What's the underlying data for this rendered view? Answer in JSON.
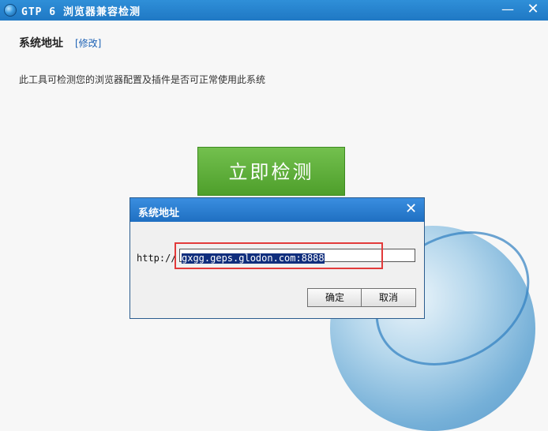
{
  "window": {
    "title": "GTP 6 浏览器兼容检测",
    "minimize": "—",
    "close": "✕"
  },
  "main": {
    "section_title": "系统地址",
    "modify_link": "[修改]",
    "description": "此工具可检测您的浏览器配置及插件是否可正常使用此系统",
    "detect_button": "立即检测"
  },
  "dialog": {
    "title": "系统地址",
    "close": "✕",
    "prefix": "http://",
    "address_value": "gxgg.geps.glodon.com:8888",
    "ok_label": "确定",
    "cancel_label": "取消"
  }
}
